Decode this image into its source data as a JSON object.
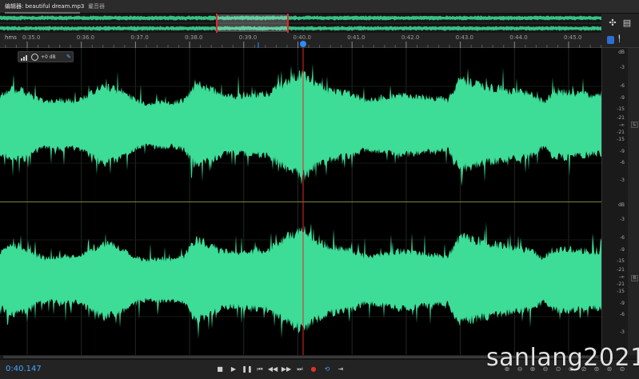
{
  "tabs": {
    "editor_label": "编辑器: beautiful dream.mp3",
    "editor_menu_icon": "menu-icon",
    "mixer_label": "混音器"
  },
  "overview": {
    "selection_color": "#e8262a",
    "wave_color": "#3ddc97"
  },
  "ruler": {
    "unit": "hms",
    "ticks": [
      "0:35.0",
      "0:36.0",
      "0:37.0",
      "0:38.0",
      "0:39.0",
      "0:40.0",
      "0:41.0",
      "0:42.0",
      "0:43.0",
      "0:44.0",
      "0:45.0"
    ]
  },
  "hud": {
    "gain": "+0 dB"
  },
  "db_scale": {
    "unit": "dB",
    "upper_labels": [
      "-3",
      "-6",
      "-9",
      "-15",
      "-21",
      "-∞",
      "-21",
      "-15",
      "-9",
      "-6",
      "-3"
    ],
    "channel_left": "L",
    "channel_right": "R"
  },
  "playhead": {
    "time": "0:40.147",
    "color": "#e8262a"
  },
  "waveform": {
    "color": "#3ddc97",
    "background": "#000000"
  },
  "transport": {
    "icons": [
      "stop-icon",
      "play-icon",
      "pause-icon",
      "go-to-start-icon",
      "rewind-icon",
      "fast-forward-icon",
      "go-to-end-icon",
      "record-icon",
      "loop-icon",
      "skip-icon"
    ]
  },
  "zoom_icons": [
    "zoom-in-amplitude-icon",
    "zoom-out-amplitude-icon",
    "zoom-in-time-icon",
    "zoom-out-time-icon",
    "zoom-out-full-icon",
    "zoom-in-selection-icon",
    "zoom-left-icon",
    "zoom-right-icon",
    "zoom-in-point-icon",
    "zoom-out-point-icon"
  ],
  "watermark": "sanlang2021"
}
